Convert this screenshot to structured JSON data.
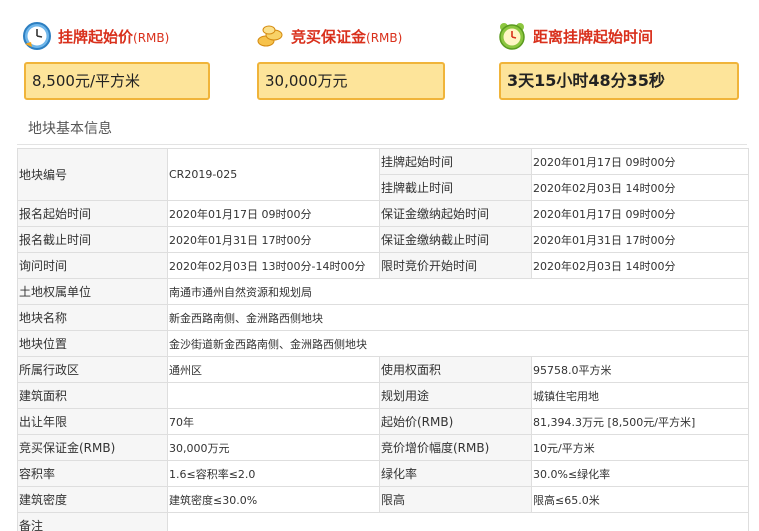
{
  "summary": {
    "start_price": {
      "icon": "clock-icon",
      "title": "挂牌起始价",
      "unit": "(RMB)",
      "value": "8,500元/平方米"
    },
    "deposit": {
      "icon": "coins-icon",
      "title": "竞买保证金",
      "unit": "(RMB)",
      "value": "30,000万元"
    },
    "countdown": {
      "icon": "alarm-clock-icon",
      "title": "距离挂牌起始时间",
      "value": "3天15小时48分35秒"
    }
  },
  "section_title": "地块基本信息",
  "rows": [
    {
      "cells": [
        {
          "text": "地块编号",
          "type": "lbl",
          "rowspan": 2
        },
        {
          "text": "CR2019-025",
          "type": "val",
          "rowspan": 2
        },
        {
          "text": "挂牌起始时间",
          "type": "lbl"
        },
        {
          "text": "2020年01月17日 09时00分",
          "type": "val"
        }
      ]
    },
    {
      "cells": [
        {
          "text": "挂牌截止时间",
          "type": "lbl"
        },
        {
          "text": "2020年02月03日 14时00分",
          "type": "val"
        }
      ]
    },
    {
      "cells": [
        {
          "text": "报名起始时间",
          "type": "lbl"
        },
        {
          "text": "2020年01月17日 09时00分",
          "type": "val"
        },
        {
          "text": "保证金缴纳起始时间",
          "type": "lbl"
        },
        {
          "text": "2020年01月17日 09时00分",
          "type": "val"
        }
      ]
    },
    {
      "cells": [
        {
          "text": "报名截止时间",
          "type": "lbl"
        },
        {
          "text": "2020年01月31日 17时00分",
          "type": "val"
        },
        {
          "text": "保证金缴纳截止时间",
          "type": "lbl"
        },
        {
          "text": "2020年01月31日 17时00分",
          "type": "val"
        }
      ]
    },
    {
      "cells": [
        {
          "text": "询问时间",
          "type": "lbl"
        },
        {
          "text": "2020年02月03日 13时00分-14时00分",
          "type": "val"
        },
        {
          "text": "限时竞价开始时间",
          "type": "lbl"
        },
        {
          "text": "2020年02月03日 14时00分",
          "type": "val"
        }
      ]
    },
    {
      "cells": [
        {
          "text": "土地权属单位",
          "type": "lbl"
        },
        {
          "text": "南通市通州自然资源和规划局",
          "type": "val",
          "colspan": 3
        }
      ]
    },
    {
      "cells": [
        {
          "text": "地块名称",
          "type": "lbl"
        },
        {
          "text": "新金西路南侧、金洲路西侧地块",
          "type": "val",
          "colspan": 3
        }
      ]
    },
    {
      "cells": [
        {
          "text": "地块位置",
          "type": "lbl"
        },
        {
          "text": "金沙街道新金西路南侧、金洲路西侧地块",
          "type": "val",
          "colspan": 3
        }
      ]
    },
    {
      "cells": [
        {
          "text": "所属行政区",
          "type": "lbl"
        },
        {
          "text": "通州区",
          "type": "val"
        },
        {
          "text": "使用权面积",
          "type": "lbl"
        },
        {
          "text": "95758.0平方米",
          "type": "val"
        }
      ]
    },
    {
      "cells": [
        {
          "text": "建筑面积",
          "type": "lbl"
        },
        {
          "text": "",
          "type": "val"
        },
        {
          "text": "规划用途",
          "type": "lbl"
        },
        {
          "text": "城镇住宅用地",
          "type": "val"
        }
      ]
    },
    {
      "cells": [
        {
          "text": "出让年限",
          "type": "lbl"
        },
        {
          "text": "70年",
          "type": "val"
        },
        {
          "text": "起始价(RMB)",
          "type": "lbl"
        },
        {
          "text": "81,394.3万元 [8,500元/平方米]",
          "type": "val"
        }
      ]
    },
    {
      "cells": [
        {
          "text": "竞买保证金(RMB)",
          "type": "lbl"
        },
        {
          "text": "30,000万元",
          "type": "val"
        },
        {
          "text": "竞价增价幅度(RMB)",
          "type": "lbl"
        },
        {
          "text": "10元/平方米",
          "type": "val"
        }
      ]
    },
    {
      "cells": [
        {
          "text": "容积率",
          "type": "lbl"
        },
        {
          "text": "1.6≤容积率≤2.0",
          "type": "val"
        },
        {
          "text": "绿化率",
          "type": "lbl"
        },
        {
          "text": "30.0%≤绿化率",
          "type": "val"
        }
      ]
    },
    {
      "cells": [
        {
          "text": "建筑密度",
          "type": "lbl"
        },
        {
          "text": "建筑密度≤30.0%",
          "type": "val"
        },
        {
          "text": "限高",
          "type": "lbl"
        },
        {
          "text": "限高≤65.0米",
          "type": "val"
        }
      ]
    },
    {
      "cells": [
        {
          "text": "备注",
          "type": "lbl"
        },
        {
          "text": "",
          "type": "val",
          "colspan": 3
        }
      ]
    }
  ]
}
